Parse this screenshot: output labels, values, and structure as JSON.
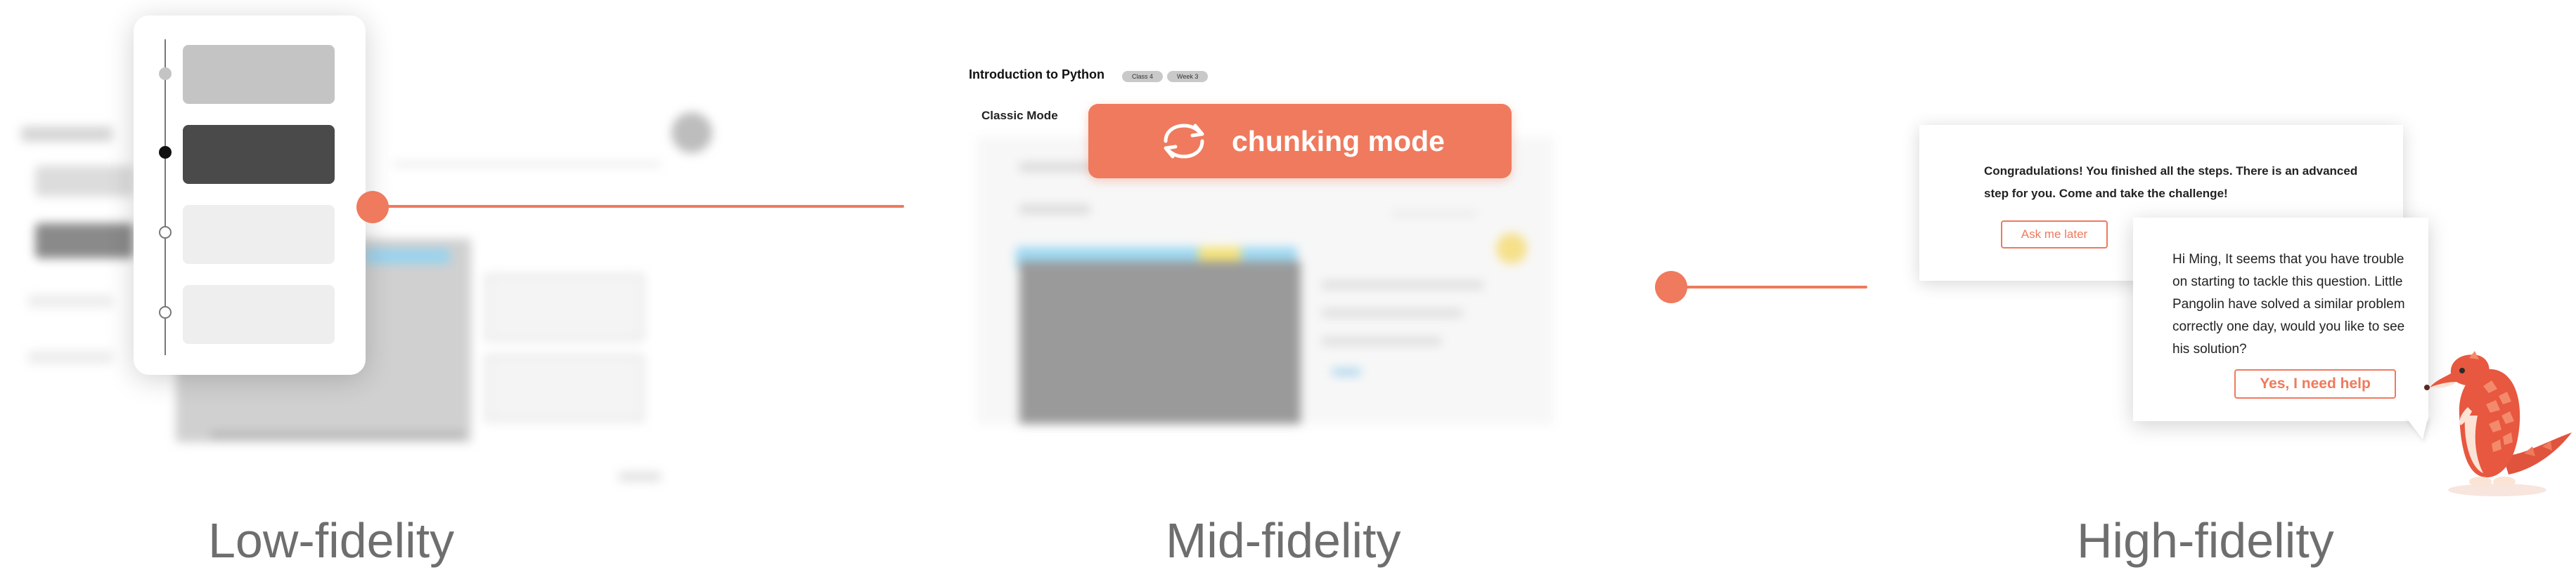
{
  "colors": {
    "accent": "#ef7a5d",
    "caption_text": "#6e6e6e",
    "wire_dark": "#4a4a4a",
    "wire_mid": "#c4c4c4",
    "wire_light": "#eeeeee"
  },
  "low_fidelity": {
    "caption": "Low-fidelity",
    "steps": [
      {
        "state": "complete",
        "shade": "mid"
      },
      {
        "state": "current",
        "shade": "dark"
      },
      {
        "state": "upcoming",
        "shade": "light"
      },
      {
        "state": "upcoming",
        "shade": "light"
      }
    ]
  },
  "mid_fidelity": {
    "caption": "Mid-fidelity",
    "title": "Introduction to Python",
    "tags": [
      "Class 4",
      "Week 3"
    ],
    "mode_label": "Classic Mode",
    "banner": {
      "icon": "refresh-cycle-icon",
      "text": "chunking mode"
    }
  },
  "high_fidelity": {
    "caption": "High-fidelity",
    "message": "Congradulations! You finished all the steps. There is an advanced step for you. Come and take the challenge!",
    "ask_later_label": "Ask me later",
    "bubble_text": "Hi Ming, It seems that you have trouble on starting to tackle this question. Little Pangolin have solved a similar problem correctly one day, would you like to see his solution?",
    "help_label": "Yes, I need help",
    "mascot": "pangolin-mascot"
  }
}
